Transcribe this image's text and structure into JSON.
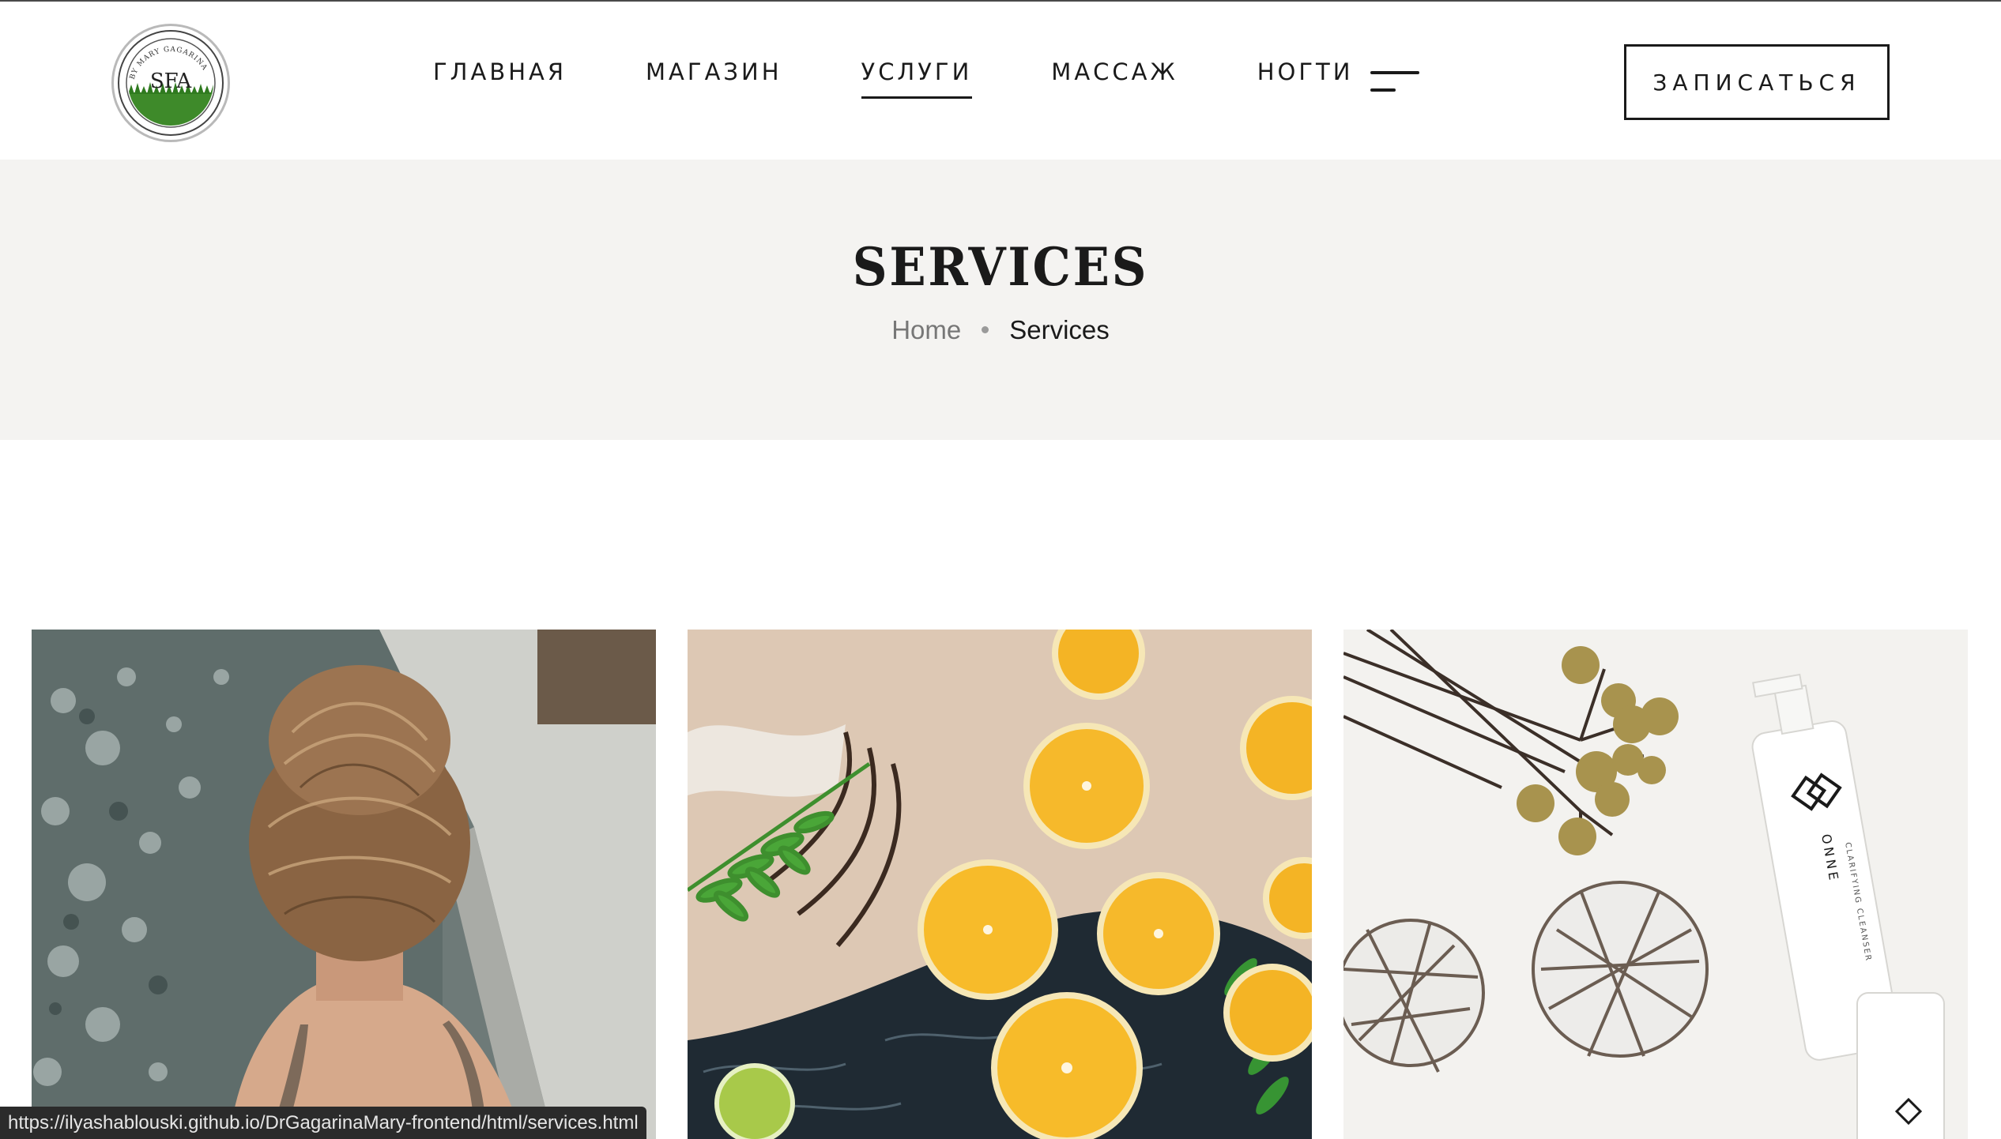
{
  "header": {
    "logo": {
      "text_main": "SFA",
      "text_ring": "BY MARY GAGARINA",
      "icon": "grass-seal-logo"
    },
    "nav": [
      {
        "label": "ГЛАВНАЯ",
        "active": false
      },
      {
        "label": "МАГАЗИН",
        "active": false
      },
      {
        "label": "УСЛУГИ",
        "active": true
      },
      {
        "label": "МАССАЖ",
        "active": false
      },
      {
        "label": "НОГТИ",
        "active": false
      }
    ],
    "menu_icon": "hamburger-menu-icon",
    "cta_label": "ЗАПИСАТЬСЯ"
  },
  "page_header": {
    "title": "SERVICES",
    "breadcrumb": {
      "home": "Home",
      "current": "Services"
    }
  },
  "services": [
    {
      "image": "woman-in-hot-tub-photo"
    },
    {
      "image": "orange-slices-bath-photo"
    },
    {
      "image": "onne-cleanser-still-life-photo",
      "product_brand": "ONNE",
      "product_name": "CLARIFYING CLEANSER"
    }
  ],
  "status_url": "https://ilyashablouski.github.io/DrGagarinaMary-frontend/html/services.html",
  "colors": {
    "text": "#1a1a1a",
    "band": "#f4f3f1",
    "status_bg": "#2b2b2b",
    "muted": "#777777"
  }
}
